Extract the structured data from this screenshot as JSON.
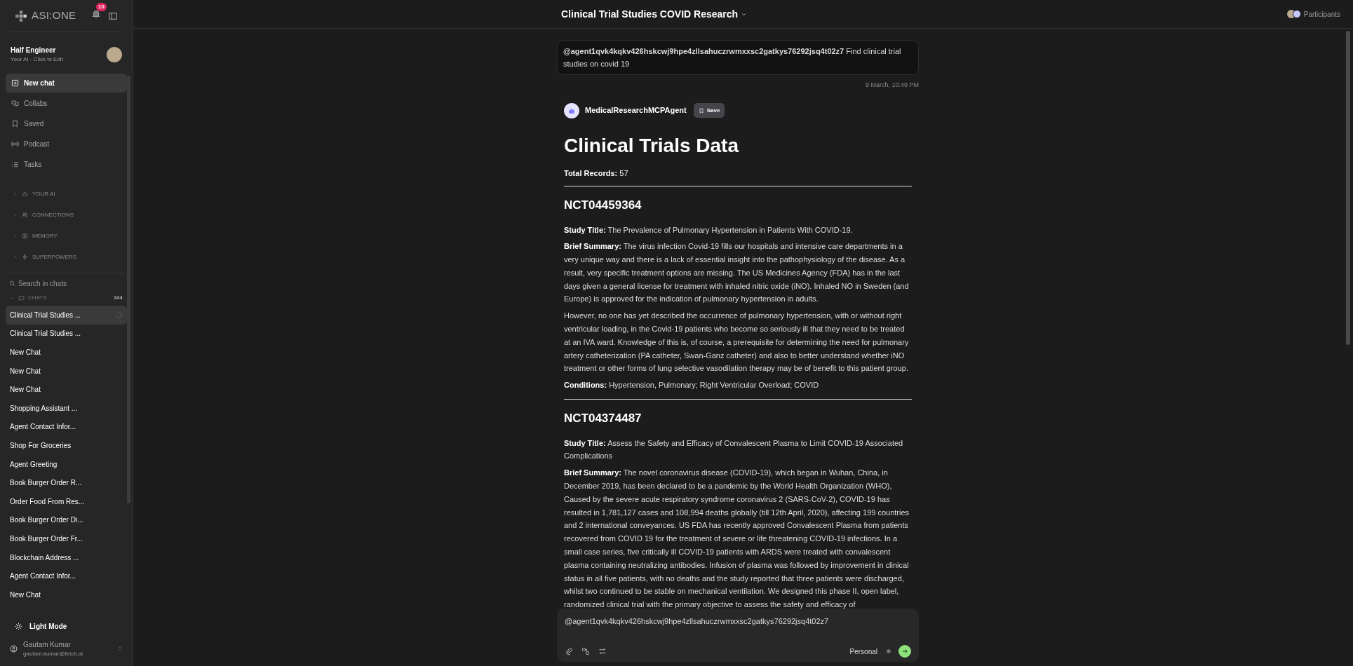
{
  "sidebar": {
    "logo": "ASI:ONE",
    "notification_count": "10",
    "profile": {
      "name": "Half Engineer",
      "subtitle": "Your AI - Click to Edit"
    },
    "nav": [
      {
        "label": "New chat",
        "selected": true
      },
      {
        "label": "Collabs",
        "selected": false
      },
      {
        "label": "Saved",
        "selected": false
      },
      {
        "label": "Podcast",
        "selected": false
      },
      {
        "label": "Tasks",
        "selected": false
      }
    ],
    "sections": [
      {
        "label": "YOUR AI",
        "expanded": false
      },
      {
        "label": "CONNECTIONS",
        "expanded": false
      },
      {
        "label": "MEMORY",
        "expanded": false
      },
      {
        "label": "SUPERPOWERS",
        "expanded": false
      }
    ],
    "search": {
      "placeholder": "Search in chats"
    },
    "chats_header": {
      "label": "CHATS",
      "count": "344",
      "expanded": true
    },
    "chats": [
      {
        "title": "Clinical Trial Studies ...",
        "selected": true,
        "loading": true
      },
      {
        "title": "Clinical Trial Studies ...",
        "selected": false,
        "loading": false
      },
      {
        "title": "New Chat",
        "selected": false,
        "loading": false
      },
      {
        "title": "New Chat",
        "selected": false,
        "loading": false
      },
      {
        "title": "New Chat",
        "selected": false,
        "loading": false
      },
      {
        "title": "Shopping Assistant ...",
        "selected": false,
        "loading": false
      },
      {
        "title": "Agent Contact Infor...",
        "selected": false,
        "loading": false
      },
      {
        "title": "Shop For Groceries",
        "selected": false,
        "loading": false
      },
      {
        "title": "Agent Greeting",
        "selected": false,
        "loading": false
      },
      {
        "title": "Book Burger Order R...",
        "selected": false,
        "loading": false
      },
      {
        "title": "Order Food From Res...",
        "selected": false,
        "loading": false
      },
      {
        "title": "Book Burger Order Di...",
        "selected": false,
        "loading": false
      },
      {
        "title": "Book Burger Order Fr...",
        "selected": false,
        "loading": false
      },
      {
        "title": "Blockchain Address ...",
        "selected": false,
        "loading": false
      },
      {
        "title": "Agent Contact Infor...",
        "selected": false,
        "loading": false
      },
      {
        "title": "New Chat",
        "selected": false,
        "loading": false
      }
    ],
    "theme_toggle": "Light Mode",
    "user": {
      "name": "Gautam Kumar",
      "email": "gautam.kumar@fetch.ai"
    }
  },
  "header": {
    "title": "Clinical Trial Studies COVID Research",
    "participants": "Participants"
  },
  "user_message": {
    "text": "**@agent1qvk4kqkv426hskcwj9hpe4zllsahuczrwmxxsc2gatkys76292jsq4t02z7** Find clinical trial studies on covid 19",
    "time": "9 March, 10:49 PM"
  },
  "agent": {
    "name": "MedicalResearchMCPAgent",
    "save": "Save"
  },
  "response": {
    "title": "Clinical Trials Data",
    "total": "**Total Records:** 57",
    "studies": [
      {
        "id": "NCT04459364",
        "paragraphs": [
          "**Study Title:** The Prevalence of Pulmonary Hypertension in Patients With COVID-19.",
          "**Brief Summary:** The virus infection Covid-19 fills our hospitals and intensive care departments in a very unique way and there is a lack of essential insight into the pathophysiology of the disease. As a result, very specific treatment options are missing. The US Medicines Agency (FDA) has in the last days given a general license for treatment with inhaled nitric oxide (iNO). Inhaled NO in Sweden (and Europe) is approved for the indication of pulmonary hypertension in adults.",
          "However, no one has yet described the occurrence of pulmonary hypertension, with or without right ventricular loading, in the Covid-19 patients who become so seriously ill that they need to be treated at an IVA ward. Knowledge of this is, of course, a prerequisite for determining the need for pulmonary artery catheterization (PA catheter, Swan-Ganz catheter) and also to better understand whether iNO treatment or other forms of lung selective vasodilation therapy may be of benefit to this patient group.",
          "**Conditions:** Hypertension, Pulmonary; Right Ventricular Overload; COVID"
        ]
      },
      {
        "id": "NCT04374487",
        "paragraphs": [
          "**Study Title:** Assess the Safety and Efficacy of Convalescent Plasma to Limit COVID-19 Associated Complications",
          "**Brief Summary:** The novel coronavirus disease (COVID-19), which began in Wuhan, China, in December 2019, has been declared to be a pandemic by the World Health Organization (WHO), Caused by the severe acute respiratory syndrome coronavirus 2 (SARS-CoV-2), COVID-19 has resulted in 1,781,127 cases and 108,994 deaths globally (till 12th April, 2020), affecting 199 countries and 2 international conveyances. US FDA has recently approved Convalescent Plasma from patients recovered from COVID 19 for the treatment of severe or life threatening COVID-19 infections. In a small case series, five critically ill COVID-19 patients with ARDS were treated with convalescent plasma containing neutralizing antibodies. Infusion of plasma was followed by improvement in clinical status in all five patients, with no deaths and the study reported that three patients were discharged, whilst two continued to be stable on mechanical ventilation. We designed this phase II, open label, randomized clinical trial with the primary objective to assess the safety and efficacy of"
        ]
      }
    ]
  },
  "composer": {
    "value": "@agent1qvk4kqkv426hskcwj9hpe4zllsahuczrwmxxsc2gatkys76292jsq4t02z7",
    "mode": "Personal"
  }
}
